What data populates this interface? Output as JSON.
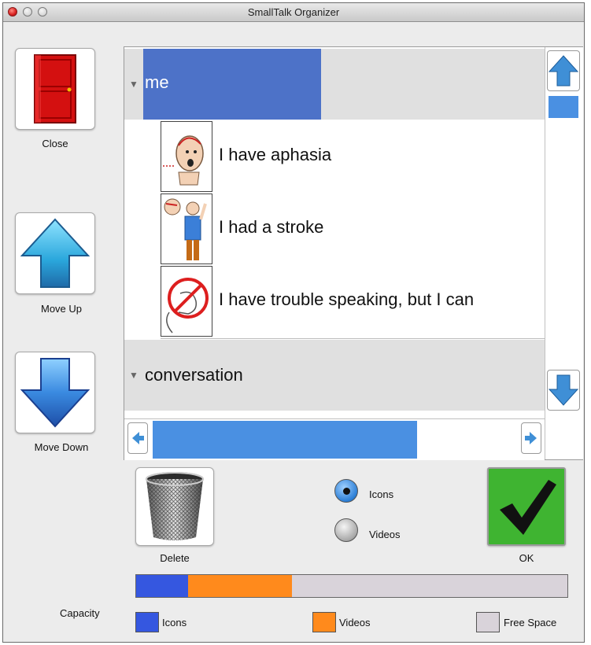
{
  "window": {
    "title": "SmallTalk Organizer"
  },
  "sidebar": {
    "close_label": "Close",
    "move_up_label": "Move Up",
    "move_down_label": "Move Down"
  },
  "list": {
    "groups": [
      {
        "name": "me",
        "selected": true
      },
      {
        "name": "conversation",
        "selected": false
      }
    ],
    "items": [
      {
        "text": "I have aphasia",
        "icon": "head-brain-icon"
      },
      {
        "text": "I had a stroke",
        "icon": "person-stroke-icon"
      },
      {
        "text": "I have trouble speaking, but I can",
        "icon": "no-speaking-icon"
      }
    ]
  },
  "bottom": {
    "delete_label": "Delete",
    "ok_label": "OK",
    "media_options": [
      {
        "label": "Icons",
        "selected": true
      },
      {
        "label": "Videos",
        "selected": false
      }
    ]
  },
  "capacity": {
    "label": "Capacity",
    "icons_fraction": 0.12,
    "videos_fraction": 0.24,
    "free_fraction": 0.64,
    "legend": {
      "icons": "Icons",
      "videos": "Videos",
      "free": "Free Space"
    },
    "colors": {
      "icons": "#3557e0",
      "videos": "#ff8a1c",
      "free": "#d9d3da"
    }
  },
  "colors": {
    "selection": "#4d72c8",
    "scroll_thumb": "#4a90e2",
    "group_bg": "#e0e0e0",
    "ok_bg": "#3fb431"
  }
}
